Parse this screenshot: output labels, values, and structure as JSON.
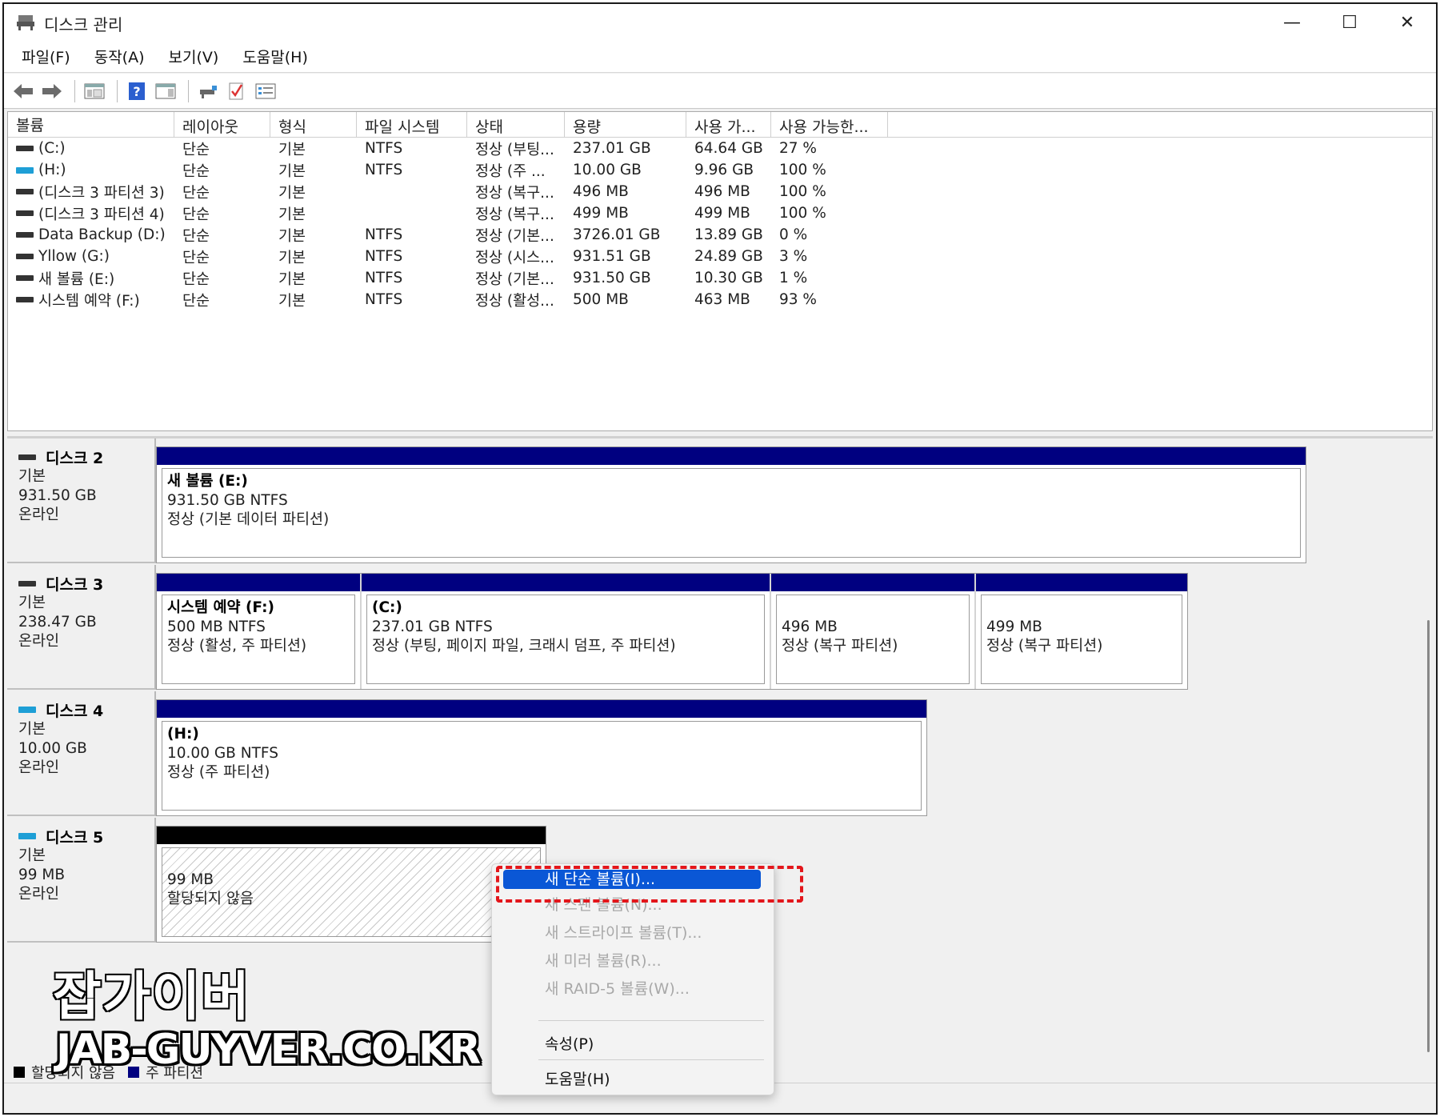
{
  "window": {
    "title": "디스크 관리",
    "controls": {
      "minimize": "—",
      "maximize": "☐",
      "close": "✕"
    }
  },
  "menu": [
    "파일(F)",
    "동작(A)",
    "보기(V)",
    "도움말(H)"
  ],
  "toolbar_icons": [
    "back-arrow-icon",
    "forward-arrow-icon",
    "console-tree-icon",
    "help-icon",
    "action-pane-icon",
    "connect-icon",
    "check-icon",
    "properties-icon"
  ],
  "volume_list": {
    "columns": [
      "볼륨",
      "레이아웃",
      "형식",
      "파일 시스템",
      "상태",
      "용량",
      "사용 가...",
      "사용 가능한..."
    ],
    "rows": [
      {
        "name": "(C:)",
        "icon": "hdd",
        "layout": "단순",
        "type": "기본",
        "fs": "NTFS",
        "status": "정상 (부팅...",
        "capacity": "237.01 GB",
        "free": "64.64 GB",
        "pct": "27 %"
      },
      {
        "name": "(H:)",
        "icon": "usb",
        "layout": "단순",
        "type": "기본",
        "fs": "NTFS",
        "status": "정상 (주 ...",
        "capacity": "10.00 GB",
        "free": "9.96 GB",
        "pct": "100 %"
      },
      {
        "name": "(디스크 3 파티션 3)",
        "icon": "hdd",
        "layout": "단순",
        "type": "기본",
        "fs": "",
        "status": "정상 (복구...",
        "capacity": "496 MB",
        "free": "496 MB",
        "pct": "100 %"
      },
      {
        "name": "(디스크 3 파티션 4)",
        "icon": "hdd",
        "layout": "단순",
        "type": "기본",
        "fs": "",
        "status": "정상 (복구...",
        "capacity": "499 MB",
        "free": "499 MB",
        "pct": "100 %"
      },
      {
        "name": "Data Backup (D:)",
        "icon": "hdd",
        "layout": "단순",
        "type": "기본",
        "fs": "NTFS",
        "status": "정상 (기본...",
        "capacity": "3726.01 GB",
        "free": "13.89 GB",
        "pct": "0 %"
      },
      {
        "name": "Yllow (G:)",
        "icon": "hdd",
        "layout": "단순",
        "type": "기본",
        "fs": "NTFS",
        "status": "정상 (시스...",
        "capacity": "931.51 GB",
        "free": "24.89 GB",
        "pct": "3 %"
      },
      {
        "name": "새 볼륨 (E:)",
        "icon": "hdd",
        "layout": "단순",
        "type": "기본",
        "fs": "NTFS",
        "status": "정상 (기본...",
        "capacity": "931.50 GB",
        "free": "10.30 GB",
        "pct": "1 %"
      },
      {
        "name": "시스템 예약 (F:)",
        "icon": "hdd",
        "layout": "단순",
        "type": "기본",
        "fs": "NTFS",
        "status": "정상 (활성...",
        "capacity": "500 MB",
        "free": "463 MB",
        "pct": "93 %"
      }
    ]
  },
  "disks": [
    {
      "name": "디스크 2",
      "icon": "hdd",
      "kind": "기본",
      "size": "931.50 GB",
      "state": "온라인",
      "partitions": [
        {
          "title": "새 볼륨  (E:)",
          "line1": "931.50 GB NTFS",
          "line2": "정상 (기본 데이터 파티션)"
        }
      ]
    },
    {
      "name": "디스크 3",
      "icon": "hdd",
      "kind": "기본",
      "size": "238.47 GB",
      "state": "온라인",
      "partitions": [
        {
          "title": "시스템 예약  (F:)",
          "line1": "500 MB NTFS",
          "line2": "정상 (활성, 주 파티션)"
        },
        {
          "title": " (C:)",
          "line1": "237.01 GB NTFS",
          "line2": "정상 (부팅, 페이지 파일, 크래시 덤프, 주 파티션)"
        },
        {
          "title": "",
          "line1": "496 MB",
          "line2": "정상 (복구 파티션)"
        },
        {
          "title": "",
          "line1": "499 MB",
          "line2": "정상 (복구 파티션)"
        }
      ]
    },
    {
      "name": "디스크 4",
      "icon": "usb",
      "kind": "기본",
      "size": "10.00 GB",
      "state": "온라인",
      "partitions": [
        {
          "title": "  (H:)",
          "line1": "10.00 GB NTFS",
          "line2": "정상 (주 파티션)"
        }
      ]
    },
    {
      "name": "디스크 5",
      "icon": "usb",
      "kind": "기본",
      "size": "99 MB",
      "state": "온라인",
      "partitions": [
        {
          "title": "",
          "line1": "99 MB",
          "line2": "할당되지 않음"
        }
      ]
    }
  ],
  "legend": [
    {
      "label": "할당되지 않음",
      "color": "#000000"
    },
    {
      "label": "주 파티션",
      "color": "#000080"
    }
  ],
  "context_menu": {
    "items": [
      {
        "label": "새 단순 볼륨(I)...",
        "state": "active"
      },
      {
        "label": "새 스팬 볼륨(N)...",
        "state": "disabled"
      },
      {
        "label": "새 스트라이프 볼륨(T)...",
        "state": "disabled"
      },
      {
        "label": "새 미러 볼륨(R)...",
        "state": "disabled"
      },
      {
        "label": "새 RAID-5 볼륨(W)...",
        "state": "disabled"
      },
      {
        "label": "속성(P)",
        "state": "enabled"
      },
      {
        "label": "도움말(H)",
        "state": "enabled"
      }
    ]
  },
  "watermark": {
    "line1": "잡가이버",
    "line2": "JAB-GUYVER.CO.KR"
  },
  "colors": {
    "primary_partition": "#000080",
    "unallocated": "#000000",
    "menu_highlight": "#0a57d6",
    "callout": "#e3161b"
  }
}
